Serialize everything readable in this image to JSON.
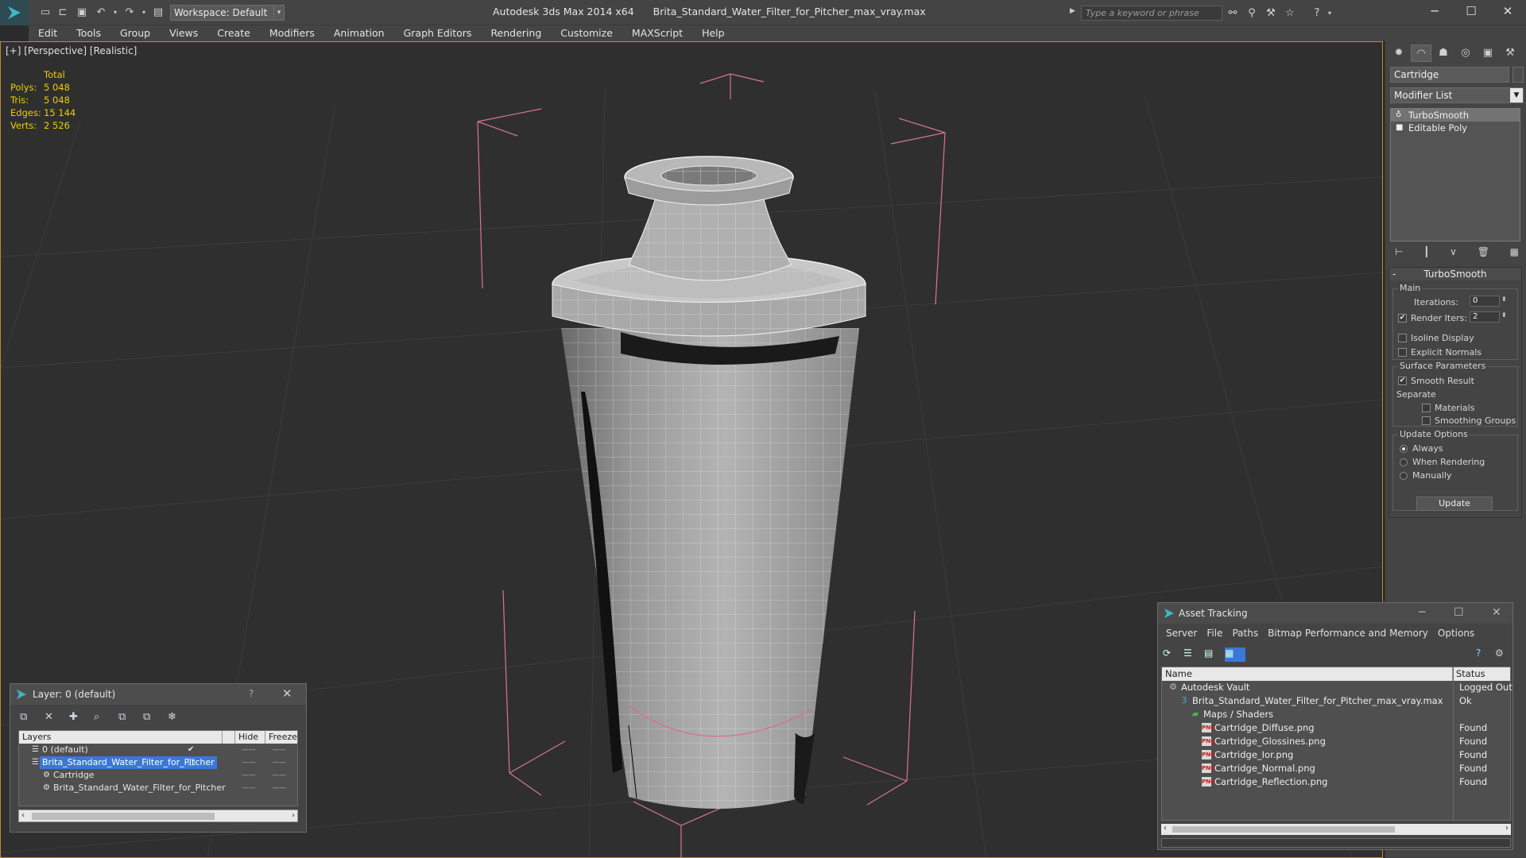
{
  "titlebar": {
    "workspace": "Workspace: Default",
    "app_name": "Autodesk 3ds Max  2014 x64",
    "file_name": "Brita_Standard_Water_Filter_for_Pitcher_max_vray.max",
    "search_placeholder": "Type a keyword or phrase",
    "minimize": "─",
    "maximize": "☐",
    "close": "✕"
  },
  "menu": [
    "Edit",
    "Tools",
    "Group",
    "Views",
    "Create",
    "Modifiers",
    "Animation",
    "Graph Editors",
    "Rendering",
    "Customize",
    "MAXScript",
    "Help"
  ],
  "viewport": {
    "label": "[+] [Perspective] [Realistic]",
    "stats": {
      "header": "Total",
      "rows": [
        {
          "label": "Polys:",
          "value": "5 048"
        },
        {
          "label": "Tris:",
          "value": "5 048"
        },
        {
          "label": "Edges:",
          "value": "15 144"
        },
        {
          "label": "Verts:",
          "value": "2 526"
        }
      ]
    }
  },
  "command_panel": {
    "object_name": "Cartridge",
    "modifier_list": "Modifier List",
    "stack": [
      "TurboSmooth",
      "Editable Poly"
    ],
    "turbosmooth": {
      "title": "TurboSmooth",
      "main_group": "Main",
      "iterations_label": "Iterations:",
      "iterations_value": "0",
      "render_iters_label": "Render Iters:",
      "render_iters_value": "2",
      "render_iters_checked": true,
      "isoline_label": "Isoline Display",
      "explicit_label": "Explicit Normals",
      "surface_group": "Surface Parameters",
      "smooth_result_label": "Smooth Result",
      "separate_label": "Separate",
      "materials_label": "Materials",
      "smoothing_groups_label": "Smoothing Groups",
      "update_group": "Update Options",
      "always_label": "Always",
      "when_rendering_label": "When Rendering",
      "manually_label": "Manually",
      "update_button": "Update"
    }
  },
  "layer_dialog": {
    "title": "Layer: 0 (default)",
    "help": "?",
    "close": "✕",
    "columns": [
      "Layers",
      "Hide",
      "Freeze"
    ],
    "rows": [
      {
        "name": "0 (default)",
        "indent": 1,
        "selected": false,
        "active_check": "✔"
      },
      {
        "name": "Brita_Standard_Water_Filter_for_Pitcher",
        "indent": 1,
        "selected": true,
        "active_check": ""
      },
      {
        "name": "Cartridge",
        "indent": 2,
        "selected": false,
        "active_check": ""
      },
      {
        "name": "Brita_Standard_Water_Filter_for_Pitcher",
        "indent": 2,
        "selected": false,
        "active_check": ""
      }
    ]
  },
  "asset_dialog": {
    "title": "Asset Tracking",
    "menu": [
      "Server",
      "File",
      "Paths",
      "Bitmap Performance and Memory",
      "Options"
    ],
    "columns": [
      "Name",
      "Status"
    ],
    "rows": [
      {
        "name": "Autodesk Vault",
        "status": "Logged Out",
        "indent": 0,
        "icon": "vault"
      },
      {
        "name": "Brita_Standard_Water_Filter_for_Pitcher_max_vray.max",
        "status": "Ok",
        "indent": 1,
        "icon": "max"
      },
      {
        "name": "Maps / Shaders",
        "status": "",
        "indent": 2,
        "icon": "folder"
      },
      {
        "name": "Cartridge_Diffuse.png",
        "status": "Found",
        "indent": 3,
        "icon": "png"
      },
      {
        "name": "Cartridge_Glossines.png",
        "status": "Found",
        "indent": 3,
        "icon": "png"
      },
      {
        "name": "Cartridge_Ior.png",
        "status": "Found",
        "indent": 3,
        "icon": "png"
      },
      {
        "name": "Cartridge_Normal.png",
        "status": "Found",
        "indent": 3,
        "icon": "png"
      },
      {
        "name": "Cartridge_Reflection.png",
        "status": "Found",
        "indent": 3,
        "icon": "png"
      }
    ],
    "png_icon_text": "PNG"
  }
}
